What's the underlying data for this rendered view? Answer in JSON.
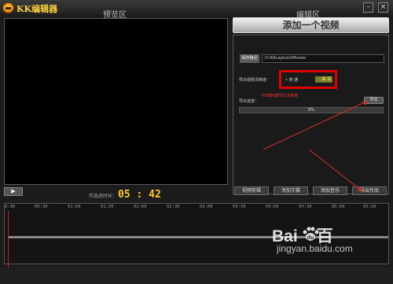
{
  "app": {
    "title": "KK编辑器",
    "minimize": "–",
    "close": "×"
  },
  "preview": {
    "title": "预览区",
    "play_icon": "▶",
    "duration_label": "作品总时长：",
    "duration_value": "05 : 42"
  },
  "editor": {
    "title": "编辑区",
    "add_video_button": "添加一个视频",
    "save_path_label": "保存路径",
    "save_path_value": "D:\\KKcapture\\Movies",
    "quality_label": "导出视频清晰度：",
    "quality_options": [
      "普 通",
      "高 清"
    ],
    "quality_selected": "高 清",
    "quality_note": "KK编辑器导出清晰度",
    "progress_label": "导出进度：",
    "export_small_button": "导出",
    "progress_percent": "0%",
    "tabs": [
      "视频剪辑",
      "添加字幕",
      "添加音乐",
      "导出作品"
    ]
  },
  "timeline": {
    "ticks": [
      "0:00",
      "00:30",
      "01:00",
      "01:30",
      "02:00",
      "02:30",
      "03:00",
      "03:30",
      "04:00",
      "04:30",
      "05:00",
      "05:30"
    ]
  },
  "watermark": {
    "brand": "Bai",
    "brand2": "百",
    "site": "jingyan.baidu.com"
  },
  "colors": {
    "accent_yellow": "#ffcc22",
    "highlight_red": "#e00000"
  }
}
